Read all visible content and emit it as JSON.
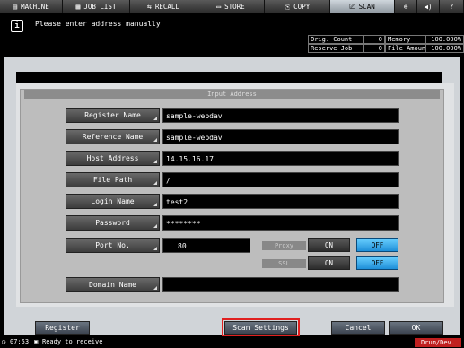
{
  "tabs": [
    {
      "label": "MACHINE",
      "icon": "machine-icon",
      "glyph": "▤"
    },
    {
      "label": "JOB LIST",
      "icon": "job-list-icon",
      "glyph": "▦"
    },
    {
      "label": "RECALL",
      "icon": "recall-icon",
      "glyph": "⇆"
    },
    {
      "label": "STORE",
      "icon": "store-icon",
      "glyph": "▭"
    },
    {
      "label": "COPY",
      "icon": "copy-icon",
      "glyph": "⎘"
    },
    {
      "label": "SCAN",
      "icon": "scan-icon",
      "glyph": "⎚"
    }
  ],
  "message": {
    "text": "Please enter address manually",
    "icon_glyph": "i"
  },
  "status": {
    "orig_count_label": "Orig. Count",
    "orig_count_value": "0",
    "memory_label": "Memory",
    "memory_value": "100.000%",
    "reserve_job_label": "Reserve Job",
    "reserve_job_value": "0",
    "file_amount_label": "File Amount",
    "file_amount_value": "100.000%"
  },
  "panel": {
    "title": "Input Address",
    "fields": [
      {
        "label": "Register Name",
        "value": "sample-webdav"
      },
      {
        "label": "Reference Name",
        "value": "sample-webdav"
      },
      {
        "label": "Host Address",
        "value": "14.15.16.17"
      },
      {
        "label": "File Path",
        "value": "/"
      },
      {
        "label": "Login Name",
        "value": "test2"
      },
      {
        "label": "Password",
        "value": "********"
      }
    ],
    "port": {
      "label": "Port No.",
      "value": "80"
    },
    "proxy": {
      "label": "Proxy",
      "on": "ON",
      "off": "OFF",
      "selected": "OFF"
    },
    "ssl": {
      "label": "SSL",
      "on": "ON",
      "off": "OFF",
      "selected": "OFF"
    },
    "domain": {
      "label": "Domain Name",
      "value": ""
    }
  },
  "footer": {
    "register": "Register",
    "scan_settings": "Scan Settings",
    "cancel": "Cancel",
    "ok": "OK"
  },
  "statusbar": {
    "time": "07:53",
    "ready": "Ready to receive",
    "warning": "Drum/Dev."
  }
}
